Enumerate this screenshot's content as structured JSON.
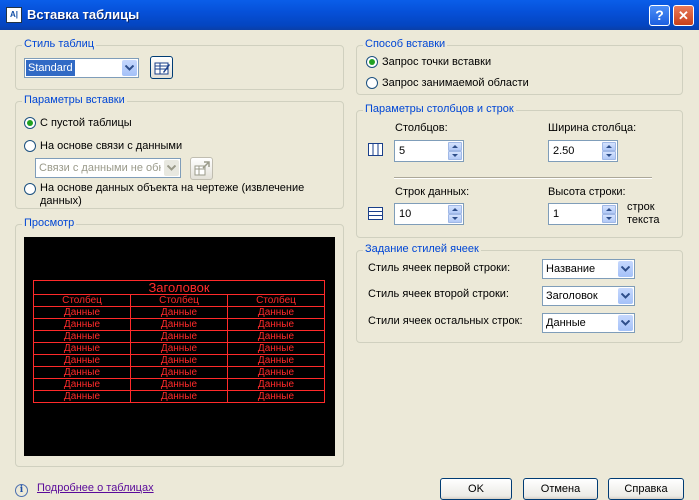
{
  "window": {
    "title": "Вставка таблицы",
    "help": "?",
    "close": "✕",
    "app_icon_text": "A|"
  },
  "table_style": {
    "legend": "Стиль таблиц",
    "value": "Standard"
  },
  "insert_options": {
    "legend": "Параметры вставки",
    "options": [
      "С пустой таблицы",
      "На основе связи с данными",
      "На основе данных объекта на чертеже (извлечение данных)"
    ],
    "selected": 0,
    "link_combo_value": "Связи с данными не обн"
  },
  "preview": {
    "legend": "Просмотр",
    "header": "Заголовок",
    "columns": [
      "Столбец",
      "Столбец",
      "Столбец"
    ],
    "rows": [
      [
        "Данные",
        "Данные",
        "Данные"
      ],
      [
        "Данные",
        "Данные",
        "Данные"
      ],
      [
        "Данные",
        "Данные",
        "Данные"
      ],
      [
        "Данные",
        "Данные",
        "Данные"
      ],
      [
        "Данные",
        "Данные",
        "Данные"
      ],
      [
        "Данные",
        "Данные",
        "Данные"
      ],
      [
        "Данные",
        "Данные",
        "Данные"
      ],
      [
        "Данные",
        "Данные",
        "Данные"
      ]
    ],
    "line_color": "#ff2a2a"
  },
  "insertion_method": {
    "legend": "Способ вставки",
    "options": [
      "Запрос точки вставки",
      "Запрос занимаемой области"
    ],
    "selected": 0
  },
  "col_row_settings": {
    "legend": "Параметры столбцов и строк",
    "columns_label": "Столбцов:",
    "columns_value": "5",
    "col_width_label": "Ширина столбца:",
    "col_width_value": "2.50",
    "data_rows_label": "Строк данных:",
    "data_rows_value": "10",
    "row_height_label": "Высота строки:",
    "row_height_value": "1",
    "row_height_unit_1": "строк",
    "row_height_unit_2": "текста"
  },
  "cell_styles": {
    "legend": "Задание стилей ячеек",
    "first_row_label": "Стиль ячеек первой строки:",
    "first_row_value": "Название",
    "second_row_label": "Стиль ячеек второй строки:",
    "second_row_value": "Заголовок",
    "other_rows_label": "Стили ячеек остальных строк:",
    "other_rows_value": "Данные"
  },
  "footer": {
    "more_link": "Подробнее о таблицах",
    "ok": "OK",
    "cancel": "Отмена",
    "help": "Справка"
  }
}
